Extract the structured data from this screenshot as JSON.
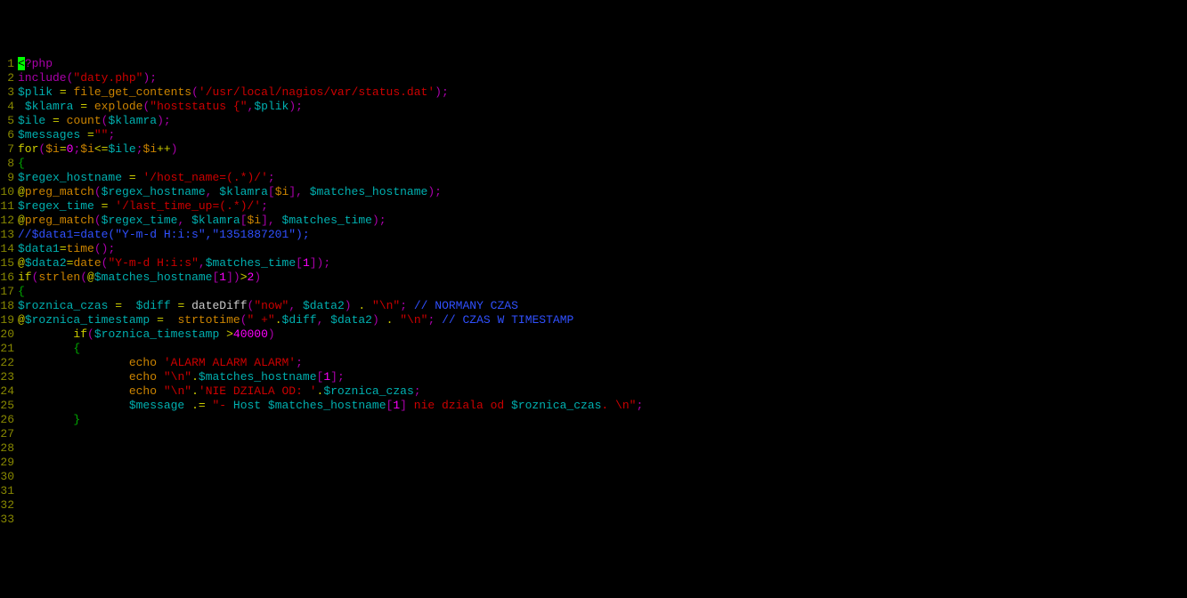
{
  "line_count": 33,
  "lines": {
    "l1": [
      [
        "cursor",
        "<"
      ],
      [
        "purple",
        "?php"
      ]
    ],
    "l2": [
      [
        "purple",
        "include("
      ],
      [
        "red",
        "\"daty.php\""
      ],
      [
        "purple",
        ");"
      ]
    ],
    "l3": [
      [
        "cyan",
        "$plik"
      ],
      [
        "default",
        " "
      ],
      [
        "yellow",
        "="
      ],
      [
        "default",
        " "
      ],
      [
        "orange",
        "file_get_contents"
      ],
      [
        "purple",
        "("
      ],
      [
        "red",
        "'/usr/local/nagios/var/status.dat'"
      ],
      [
        "purple",
        ");"
      ]
    ],
    "l4": [
      [
        "default",
        " "
      ],
      [
        "cyan",
        "$klamra"
      ],
      [
        "default",
        " "
      ],
      [
        "yellow",
        "="
      ],
      [
        "default",
        " "
      ],
      [
        "orange",
        "explode"
      ],
      [
        "purple",
        "("
      ],
      [
        "red",
        "\"hoststatus {\""
      ],
      [
        "purple",
        ","
      ],
      [
        "cyan",
        "$plik"
      ],
      [
        "purple",
        ");"
      ]
    ],
    "l5": [
      [
        "cyan",
        "$ile"
      ],
      [
        "default",
        " "
      ],
      [
        "yellow",
        "="
      ],
      [
        "default",
        " "
      ],
      [
        "orange",
        "count"
      ],
      [
        "purple",
        "("
      ],
      [
        "cyan",
        "$klamra"
      ],
      [
        "purple",
        ");"
      ]
    ],
    "l6": [
      [
        "cyan",
        "$messages"
      ],
      [
        "default",
        " "
      ],
      [
        "yellow",
        "="
      ],
      [
        "red",
        "\"\""
      ],
      [
        "purple",
        ";"
      ]
    ],
    "l7": [
      [
        "yellow",
        "for"
      ],
      [
        "purple",
        "("
      ],
      [
        "orange",
        "$i"
      ],
      [
        "yellow",
        "="
      ],
      [
        "magenta",
        "0"
      ],
      [
        "purple",
        ";"
      ],
      [
        "orange",
        "$i"
      ],
      [
        "yellow",
        "<="
      ],
      [
        "cyan",
        "$ile"
      ],
      [
        "purple",
        ";"
      ],
      [
        "orange",
        "$i"
      ],
      [
        "yellow",
        "++"
      ],
      [
        "purple",
        ")"
      ]
    ],
    "l8": [
      [
        "green",
        "{"
      ]
    ],
    "l9": [
      [
        "cyan",
        "$regex_hostname"
      ],
      [
        "default",
        " "
      ],
      [
        "yellow",
        "="
      ],
      [
        "default",
        " "
      ],
      [
        "red",
        "'/host_name=(.*)/'"
      ],
      [
        "purple",
        ";"
      ]
    ],
    "l10": [
      [
        "yellow",
        "@"
      ],
      [
        "orange",
        "preg_match"
      ],
      [
        "purple",
        "("
      ],
      [
        "cyan",
        "$regex_hostname"
      ],
      [
        "purple",
        ", "
      ],
      [
        "cyan",
        "$klamra"
      ],
      [
        "purple",
        "["
      ],
      [
        "orange",
        "$i"
      ],
      [
        "purple",
        "], "
      ],
      [
        "cyan",
        "$matches_hostname"
      ],
      [
        "purple",
        ");"
      ]
    ],
    "l11": [
      [
        "default",
        ""
      ]
    ],
    "l12": [
      [
        "cyan",
        "$regex_time"
      ],
      [
        "default",
        " "
      ],
      [
        "yellow",
        "="
      ],
      [
        "default",
        " "
      ],
      [
        "red",
        "'/last_time_up=(.*)/'"
      ],
      [
        "purple",
        ";"
      ]
    ],
    "l13": [
      [
        "yellow",
        "@"
      ],
      [
        "orange",
        "preg_match"
      ],
      [
        "purple",
        "("
      ],
      [
        "cyan",
        "$regex_time"
      ],
      [
        "purple",
        ", "
      ],
      [
        "cyan",
        "$klamra"
      ],
      [
        "purple",
        "["
      ],
      [
        "orange",
        "$i"
      ],
      [
        "purple",
        "], "
      ],
      [
        "cyan",
        "$matches_time"
      ],
      [
        "purple",
        ");"
      ]
    ],
    "l14": [
      [
        "default",
        ""
      ]
    ],
    "l15": [
      [
        "blue",
        "//$data1=date(\"Y-m-d H:i:s\",\"1351887201\");"
      ]
    ],
    "l16": [
      [
        "cyan",
        "$data1"
      ],
      [
        "yellow",
        "="
      ],
      [
        "orange",
        "time"
      ],
      [
        "purple",
        "();"
      ]
    ],
    "l17": [
      [
        "yellow",
        "@"
      ],
      [
        "cyan",
        "$data2"
      ],
      [
        "yellow",
        "="
      ],
      [
        "orange",
        "date"
      ],
      [
        "purple",
        "("
      ],
      [
        "red",
        "\"Y-m-d H:i:s\""
      ],
      [
        "purple",
        ","
      ],
      [
        "cyan",
        "$matches_time"
      ],
      [
        "purple",
        "["
      ],
      [
        "magenta",
        "1"
      ],
      [
        "purple",
        "]);"
      ]
    ],
    "l18": [
      [
        "default",
        ""
      ]
    ],
    "l19": [
      [
        "yellow",
        "if"
      ],
      [
        "purple",
        "("
      ],
      [
        "orange",
        "strlen"
      ],
      [
        "purple",
        "("
      ],
      [
        "yellow",
        "@"
      ],
      [
        "cyan",
        "$matches_hostname"
      ],
      [
        "purple",
        "["
      ],
      [
        "magenta",
        "1"
      ],
      [
        "purple",
        "])"
      ],
      [
        "yellow",
        ">"
      ],
      [
        "magenta",
        "2"
      ],
      [
        "purple",
        ")"
      ]
    ],
    "l20": [
      [
        "green",
        "{"
      ]
    ],
    "l21": [
      [
        "default",
        ""
      ]
    ],
    "l22": [
      [
        "cyan",
        "$roznica_czas"
      ],
      [
        "default",
        " "
      ],
      [
        "yellow",
        "="
      ],
      [
        "default",
        "  "
      ],
      [
        "cyan",
        "$diff"
      ],
      [
        "default",
        " "
      ],
      [
        "yellow",
        "="
      ],
      [
        "default",
        " dateDiff"
      ],
      [
        "purple",
        "("
      ],
      [
        "red",
        "\"now\""
      ],
      [
        "purple",
        ", "
      ],
      [
        "cyan",
        "$data2"
      ],
      [
        "purple",
        ")"
      ],
      [
        "default",
        " "
      ],
      [
        "yellow",
        "."
      ],
      [
        "default",
        " "
      ],
      [
        "red",
        "\"\\n\""
      ],
      [
        "purple",
        ";"
      ],
      [
        "default",
        " "
      ],
      [
        "blue",
        "// NORMANY CZAS"
      ]
    ],
    "l23": [
      [
        "yellow",
        "@"
      ],
      [
        "cyan",
        "$roznica_timestamp"
      ],
      [
        "default",
        " "
      ],
      [
        "yellow",
        "="
      ],
      [
        "default",
        "  "
      ],
      [
        "orange",
        "strtotime"
      ],
      [
        "purple",
        "("
      ],
      [
        "red",
        "\" +\""
      ],
      [
        "yellow",
        "."
      ],
      [
        "cyan",
        "$diff"
      ],
      [
        "purple",
        ", "
      ],
      [
        "cyan",
        "$data2"
      ],
      [
        "purple",
        ")"
      ],
      [
        "default",
        " "
      ],
      [
        "yellow",
        "."
      ],
      [
        "default",
        " "
      ],
      [
        "red",
        "\"\\n\""
      ],
      [
        "purple",
        ";"
      ],
      [
        "default",
        " "
      ],
      [
        "blue",
        "// CZAS W TIMESTAMP"
      ]
    ],
    "l24": [
      [
        "default",
        "        "
      ],
      [
        "yellow",
        "if"
      ],
      [
        "purple",
        "("
      ],
      [
        "cyan",
        "$roznica_timestamp"
      ],
      [
        "default",
        " "
      ],
      [
        "yellow",
        ">"
      ],
      [
        "magenta",
        "40000"
      ],
      [
        "purple",
        ")"
      ]
    ],
    "l25": [
      [
        "default",
        "        "
      ],
      [
        "green",
        "{"
      ]
    ],
    "l26": [
      [
        "default",
        "                "
      ],
      [
        "orange",
        "echo"
      ],
      [
        "default",
        " "
      ],
      [
        "red",
        "'ALARM ALARM ALARM'"
      ],
      [
        "purple",
        ";"
      ]
    ],
    "l27": [
      [
        "default",
        "                "
      ],
      [
        "orange",
        "echo"
      ],
      [
        "default",
        " "
      ],
      [
        "red",
        "\"\\n\""
      ],
      [
        "yellow",
        "."
      ],
      [
        "cyan",
        "$matches_hostname"
      ],
      [
        "purple",
        "["
      ],
      [
        "magenta",
        "1"
      ],
      [
        "purple",
        "];"
      ]
    ],
    "l28": [
      [
        "default",
        "                "
      ],
      [
        "orange",
        "echo"
      ],
      [
        "default",
        " "
      ],
      [
        "red",
        "\"\\n\""
      ],
      [
        "yellow",
        "."
      ],
      [
        "red",
        "'NIE DZIALA OD: '"
      ],
      [
        "yellow",
        "."
      ],
      [
        "cyan",
        "$roznica_czas"
      ],
      [
        "purple",
        ";"
      ]
    ],
    "l29": [
      [
        "default",
        ""
      ]
    ],
    "l30": [
      [
        "default",
        "                "
      ],
      [
        "cyan",
        "$message"
      ],
      [
        "default",
        " "
      ],
      [
        "yellow",
        ".="
      ],
      [
        "default",
        " "
      ],
      [
        "red",
        "\"- "
      ],
      [
        "cyan",
        "Host $matches_hostname"
      ],
      [
        "purple",
        "["
      ],
      [
        "magenta",
        "1"
      ],
      [
        "purple",
        "]"
      ],
      [
        "red",
        " nie dziala od "
      ],
      [
        "cyan",
        "$roznica_czas"
      ],
      [
        "red",
        ". \\n\""
      ],
      [
        "purple",
        ";"
      ]
    ],
    "l31": [
      [
        "default",
        "        "
      ],
      [
        "green",
        "}"
      ]
    ],
    "l32": [
      [
        "default",
        ""
      ]
    ],
    "l33": [
      [
        "default",
        ""
      ]
    ]
  }
}
